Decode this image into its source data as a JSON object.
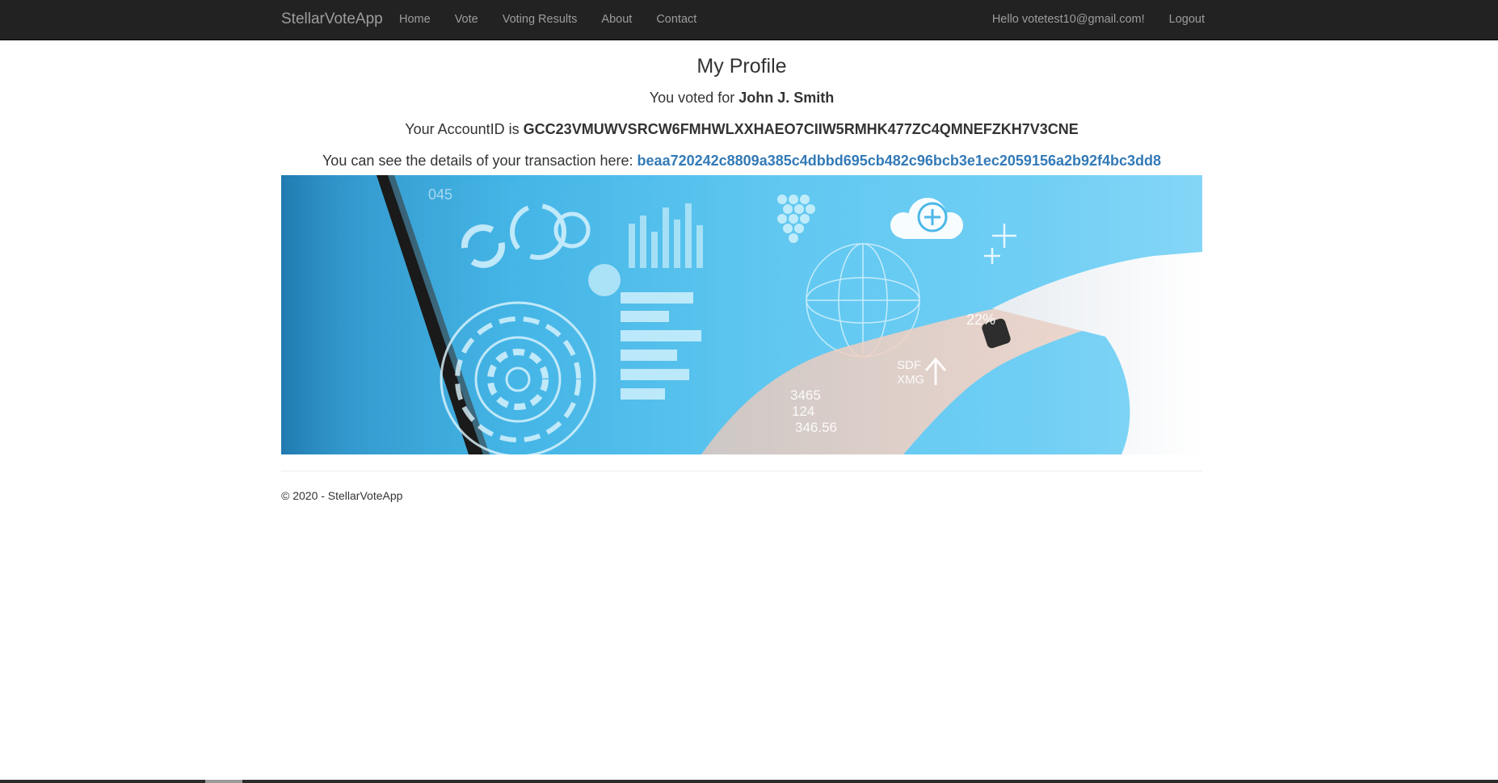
{
  "navbar": {
    "brand": "StellarVoteApp",
    "items": [
      {
        "label": "Home"
      },
      {
        "label": "Vote"
      },
      {
        "label": "Voting Results"
      },
      {
        "label": "About"
      },
      {
        "label": "Contact"
      }
    ],
    "user_greeting": "Hello votetest10@gmail.com!",
    "logout_label": "Logout"
  },
  "profile": {
    "title": "My Profile",
    "voted_prefix": "You voted for ",
    "voted_candidate": "John J. Smith",
    "account_prefix": "Your AccountID is ",
    "account_id": "GCC23VMUWVSRCW6FMHWLXXHAEO7CIIW5RMHK477ZC4QMNEFZKH7V3CNE",
    "tx_prefix": "You can see the details of your transaction here: ",
    "tx_hash": "beaa720242c8809a385c4dbbd695cb482c96bcb3e1ec2059156a2b92f4bc3dd8"
  },
  "banner": {
    "overlay_numbers": [
      "22%",
      "SDF",
      "XMG",
      "3465",
      "124",
      "346.56",
      "045"
    ]
  },
  "footer": {
    "text": "© 2020 - StellarVoteApp"
  },
  "colors": {
    "navbar_bg": "#222222",
    "nav_text": "#9d9d9d",
    "link": "#337ab7",
    "banner_blue": "#61c8f1"
  }
}
